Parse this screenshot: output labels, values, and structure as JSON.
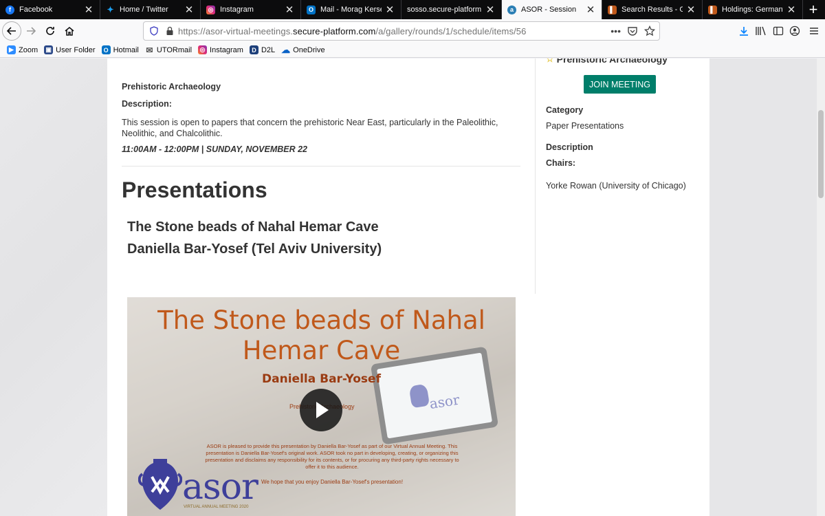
{
  "tabs": [
    {
      "title": "Facebook",
      "icon": "facebook-icon",
      "color": "#1877f2",
      "glyph": "f"
    },
    {
      "title": "Home / Twitter",
      "icon": "twitter-icon",
      "color": "#1da1f2",
      "glyph": "t"
    },
    {
      "title": "Instagram",
      "icon": "instagram-icon",
      "color": "#c13584",
      "glyph": "◎"
    },
    {
      "title": "Mail - Morag Kersel -",
      "icon": "outlook-icon",
      "color": "#0072c6",
      "glyph": "O"
    },
    {
      "title": "sosso.secure-platform.com",
      "icon": "",
      "color": "",
      "glyph": ""
    },
    {
      "title": "ASOR - Session",
      "icon": "asor-icon",
      "color": "#2b7fb5",
      "glyph": "a"
    },
    {
      "title": "Search Results - Germ",
      "icon": "library-icon",
      "color": "#c0591b",
      "glyph": "▌"
    },
    {
      "title": "Holdings: Germany an",
      "icon": "library-icon",
      "color": "#c0591b",
      "glyph": "▌"
    }
  ],
  "url": {
    "prefix": "https://asor-virtual-meetings.",
    "domain": "secure-platform.com",
    "path": "/a/gallery/rounds/1/schedule/items/56"
  },
  "bookmarks": [
    {
      "label": "Zoom",
      "icon": "zoom-icon",
      "color": "#2d8cff",
      "glyph": "▶"
    },
    {
      "label": "User Folder",
      "icon": "folder-icon",
      "color": "#2c4a8a",
      "glyph": "▣"
    },
    {
      "label": "Hotmail",
      "icon": "outlook-icon",
      "color": "#0072c6",
      "glyph": "O"
    },
    {
      "label": "UTORmail",
      "icon": "mail-icon",
      "color": "#555555",
      "glyph": "✉"
    },
    {
      "label": "Instagram",
      "icon": "instagram-icon",
      "color": "#c13584",
      "glyph": "◎"
    },
    {
      "label": "D2L",
      "icon": "d2l-icon",
      "color": "#1d3f7a",
      "glyph": "D"
    },
    {
      "label": "OneDrive",
      "icon": "onedrive-icon",
      "color": "#0a62c6",
      "glyph": "☁"
    }
  ],
  "session": {
    "name": "Prehistoric Archaeology",
    "description_label": "Description:",
    "description": "This session is open to papers that concern the prehistoric Near East, particularly in the Paleolithic, Neolithic, and Chalcolithic.",
    "time": "11:00AM - 12:00PM | SUNDAY, NOVEMBER 22"
  },
  "presentations": {
    "heading": "Presentations",
    "items": [
      {
        "title": "The Stone beads of Nahal Hemar Cave",
        "author": "Daniella Bar-Yosef (Tel Aviv University)"
      }
    ]
  },
  "video": {
    "title": "The Stone beads of Nahal Hemar Cave",
    "author": "Daniella Bar-Yosef",
    "session": "Prehistoric Archaeology",
    "notice": "ASOR is pleased to provide this presentation by Daniella Bar-Yosef as part of our Virtual Annual Meeting. This presentation is Daniella Bar-Yosef's original work. ASOR took no part in developing, creating, or organizing this presentation and disclaims any responsibility for its contents, or for procuring any third-party rights necessary to offer it to this audience.",
    "enjoy": "We hope that you enjoy Daniella Bar-Yosef's presentation!",
    "logo_word": "asor",
    "logo_sub": "VIRTUAL ANNUAL MEETING 2020",
    "brand_color": "#3e3f9a",
    "title_color": "#c0591b"
  },
  "sidebar": {
    "title": "Prehistoric Archaeology",
    "join_label": "JOIN MEETING",
    "join_color": "#007e6a",
    "category_label": "Category",
    "category_value": "Paper Presentations",
    "description_label": "Description",
    "chairs_label": "Chairs:",
    "chairs_value": "Yorke Rowan (University of Chicago)"
  }
}
